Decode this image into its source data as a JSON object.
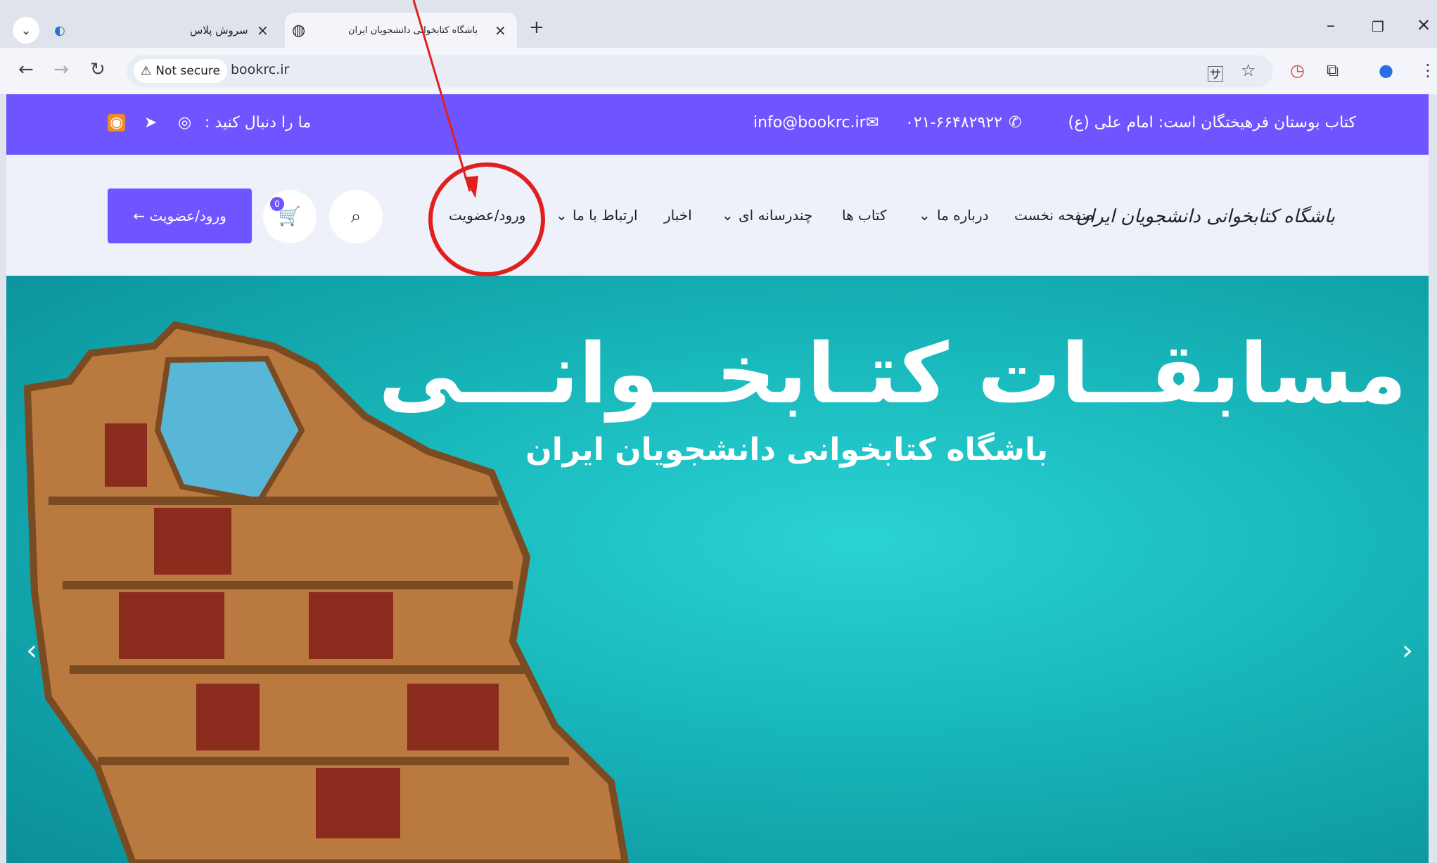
{
  "browser": {
    "tabs": [
      {
        "title": "سروش پلاس"
      },
      {
        "title": "باشگاه کتابخوانی دانشجویان ایران"
      }
    ],
    "new_tab": "+",
    "security_label": "Not secure",
    "url": "bookrc.ir"
  },
  "topbar": {
    "slogan": "کتاب بوستان فرهیختگان است: امام علی (ع)",
    "phone": "۰۲۱-۶۶۴۸۲۹۲۲",
    "email": "info@bookrc.ir",
    "follow": "ما را دنبال کنید :"
  },
  "nav": {
    "logo": "باشگاه کتابخوانی دانشجویان ایران",
    "home": "صفحه نخست",
    "about": "درباره ما",
    "books": "کتاب ها",
    "multimedia": "چندرسانه ای",
    "news": "اخبار",
    "contact": "ارتباط با ما",
    "login_link": "ورود/عضویت",
    "cart_count": "0",
    "login_button": "ورود/عضویت ←"
  },
  "hero": {
    "title": "مسابقــات کتـابخــوانـــی",
    "subtitle": "باشگاه کتابخوانی دانشجویان ایران"
  },
  "colors": {
    "brand_purple": "#6f55ff",
    "annotation_red": "#e0201f",
    "hero_teal": "#17b5b9"
  }
}
